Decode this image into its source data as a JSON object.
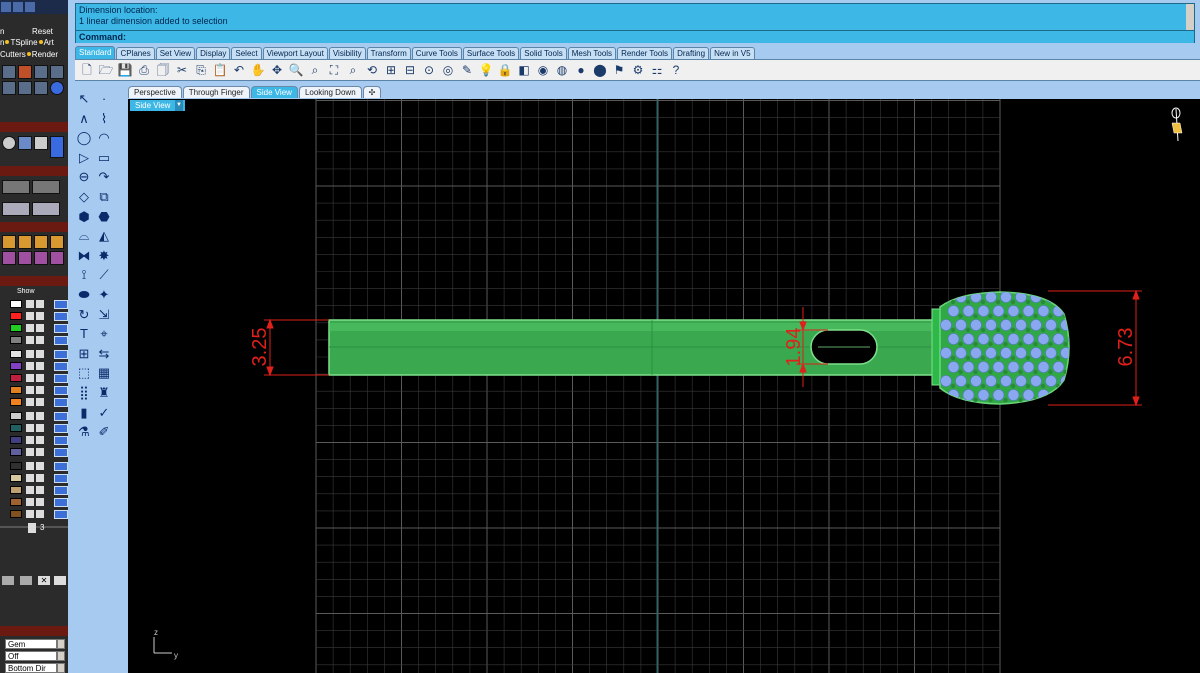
{
  "left_panel": {
    "row1": "n",
    "row1_right": "Reset",
    "row2_items": [
      "n",
      "TSpline",
      "Art"
    ],
    "row3_items": [
      "Cutters",
      "Render"
    ],
    "layers_header": "Show",
    "page_number": "3",
    "field1": "Gem",
    "field2": "Off",
    "field3": "Bottom Dir"
  },
  "command": {
    "history": [
      "Dimension location:",
      "1 linear dimension added to selection"
    ],
    "prompt_label": "Command:"
  },
  "toolbar_tabs": [
    "Standard",
    "CPlanes",
    "Set View",
    "Display",
    "Select",
    "Viewport Layout",
    "Visibility",
    "Transform",
    "Curve Tools",
    "Surface Tools",
    "Solid Tools",
    "Mesh Tools",
    "Render Tools",
    "Drafting",
    "New in V5"
  ],
  "toolbar_icons": [
    "new-file-icon",
    "open-file-icon",
    "save-icon",
    "print-icon",
    "import-icon",
    "cut-icon",
    "copy-icon",
    "paste-icon",
    "undo-icon",
    "pan-icon",
    "rotate-icon",
    "zoom-icon",
    "zoom-window-icon",
    "zoom-extents-icon",
    "zoom-selected-icon",
    "rotate-view-icon",
    "four-viewports-icon",
    "cplane-icon",
    "grid-snap-icon",
    "osnap-icon",
    "properties-icon",
    "light-icon",
    "lock-icon",
    "layer-icon",
    "color-icon",
    "render-icon",
    "shaded-icon",
    "rendered-icon",
    "osnap-settings-icon",
    "gear-icon",
    "plugin-icon",
    "help-icon"
  ],
  "viewport_tabs": [
    "Perspective",
    "Through Finger",
    "Side View",
    "Looking Down"
  ],
  "active_viewport_tab": "Side View",
  "viewport": {
    "title": "Side View",
    "axis_labels": {
      "z": "z",
      "y": "y"
    }
  },
  "dimensions": {
    "shank_height": "3.25",
    "slot_height": "1.94",
    "head_height": "6.73"
  },
  "colors": {
    "command_bg": "#3cb7e6",
    "dimension": "#e0201a",
    "model_green": "#2fb84a",
    "gem_blue": "#8aa8f0",
    "grid": "#3a3a3a"
  }
}
